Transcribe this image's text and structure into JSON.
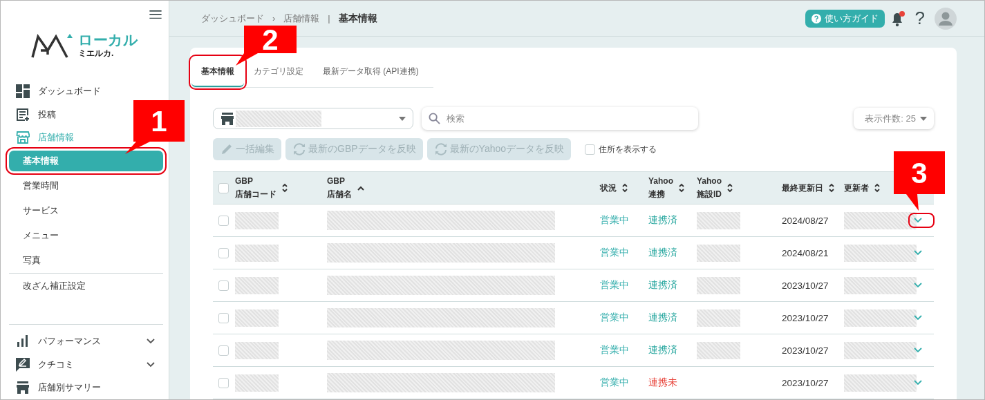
{
  "sidebar": {
    "logo": {
      "line1": "ローカル",
      "line2": "ミエルカ."
    },
    "items": [
      {
        "label": "ダッシュボード"
      },
      {
        "label": "投稿"
      },
      {
        "label": "店舗情報",
        "active": true,
        "children": [
          {
            "label": "基本情報",
            "selected": true,
            "highlighted": true,
            "separated": false
          },
          {
            "label": "営業時間",
            "selected": false,
            "highlighted": false,
            "separated": false
          },
          {
            "label": "サービス",
            "selected": false,
            "highlighted": false,
            "separated": false
          },
          {
            "label": "メニュー",
            "selected": false,
            "highlighted": false,
            "separated": false
          },
          {
            "label": "写真",
            "selected": false,
            "highlighted": false,
            "separated": false
          },
          {
            "label": "改ざん補正設定",
            "selected": false,
            "highlighted": false,
            "separated": true
          }
        ]
      }
    ],
    "more_items": [
      {
        "label": "パフォーマンス",
        "expanded": false
      },
      {
        "label": "クチコミ",
        "expanded": false
      },
      {
        "label": "店舗別サマリー"
      }
    ]
  },
  "header": {
    "breadcrumb": [
      {
        "label": "ダッシュボード",
        "separator": "›",
        "current": false
      },
      {
        "label": "店舗情報",
        "separator": "|",
        "current": false
      },
      {
        "label": "基本情報",
        "current": true
      }
    ],
    "guide_button": "使い方ガイド",
    "notifications": {
      "unread": true
    },
    "help": "?"
  },
  "tabs": [
    {
      "label": "基本情報",
      "selected": true,
      "highlighted": true
    },
    {
      "label": "カテゴリ設定",
      "selected": false,
      "highlighted": false
    },
    {
      "label": "最新データ取得 (API連携)",
      "selected": false,
      "highlighted": false
    }
  ],
  "store_select": {
    "redacted": true
  },
  "search": {
    "placeholder": "検索"
  },
  "page_size": "表示件数: 25",
  "actions": [
    {
      "label": "一括編集",
      "disabled": true
    },
    {
      "label": "最新のGBPデータを反映",
      "disabled": true
    },
    {
      "label": "最新のYahooデータを反映",
      "disabled": true
    }
  ],
  "show_address": {
    "label": "住所を表示する",
    "checked": false
  },
  "table": {
    "select_all": false,
    "columns": [
      {
        "lines": [
          "GBP",
          "店舗コード"
        ],
        "sorted": false
      },
      {
        "lines": [
          "GBP",
          "店舗名"
        ],
        "sorted": true
      },
      {
        "lines": [
          "状況"
        ],
        "sorted": false
      },
      {
        "lines": [
          "Yahoo",
          "連携"
        ],
        "sorted": false
      },
      {
        "lines": [
          "Yahoo",
          "施設ID"
        ],
        "sorted": false
      },
      {
        "lines": [
          "最終更新日"
        ],
        "sorted": false
      },
      {
        "lines": [
          "更新者"
        ],
        "sorted": false
      }
    ],
    "rows": [
      {
        "checked": false,
        "code_redacted": true,
        "name_redacted": true,
        "status": "営業中",
        "link": {
          "text": "連携済",
          "color": "#2aa8a0"
        },
        "yahoo_id_redacted": true,
        "date": "2024/08/27",
        "updater_redacted": true,
        "expanded": false,
        "highlighted": true
      },
      {
        "checked": false,
        "code_redacted": true,
        "name_redacted": true,
        "status": "営業中",
        "link": {
          "text": "連携済",
          "color": "#2aa8a0"
        },
        "yahoo_id_redacted": true,
        "date": "2024/08/21",
        "updater_redacted": true,
        "expanded": false,
        "highlighted": false
      },
      {
        "checked": false,
        "code_redacted": true,
        "name_redacted": true,
        "status": "営業中",
        "link": {
          "text": "連携済",
          "color": "#2aa8a0"
        },
        "yahoo_id_redacted": true,
        "date": "2023/10/27",
        "updater_redacted": true,
        "expanded": false,
        "highlighted": false
      },
      {
        "checked": false,
        "code_redacted": true,
        "name_redacted": true,
        "status": "営業中",
        "link": {
          "text": "連携済",
          "color": "#2aa8a0"
        },
        "yahoo_id_redacted": true,
        "date": "2023/10/27",
        "updater_redacted": true,
        "expanded": false,
        "highlighted": false
      },
      {
        "checked": false,
        "code_redacted": true,
        "name_redacted": true,
        "status": "営業中",
        "link": {
          "text": "連携済",
          "color": "#2aa8a0"
        },
        "yahoo_id_redacted": true,
        "date": "2023/10/27",
        "updater_redacted": true,
        "expanded": false,
        "highlighted": false
      },
      {
        "checked": false,
        "code_redacted": true,
        "name_redacted": true,
        "status": "営業中",
        "link": {
          "text": "連携未",
          "color": "#e8433a"
        },
        "date": "2023/10/27",
        "updater_redacted": true,
        "expanded": false,
        "highlighted": false
      }
    ]
  },
  "callouts": [
    {
      "label": "1"
    },
    {
      "label": "2"
    },
    {
      "label": "3"
    }
  ]
}
